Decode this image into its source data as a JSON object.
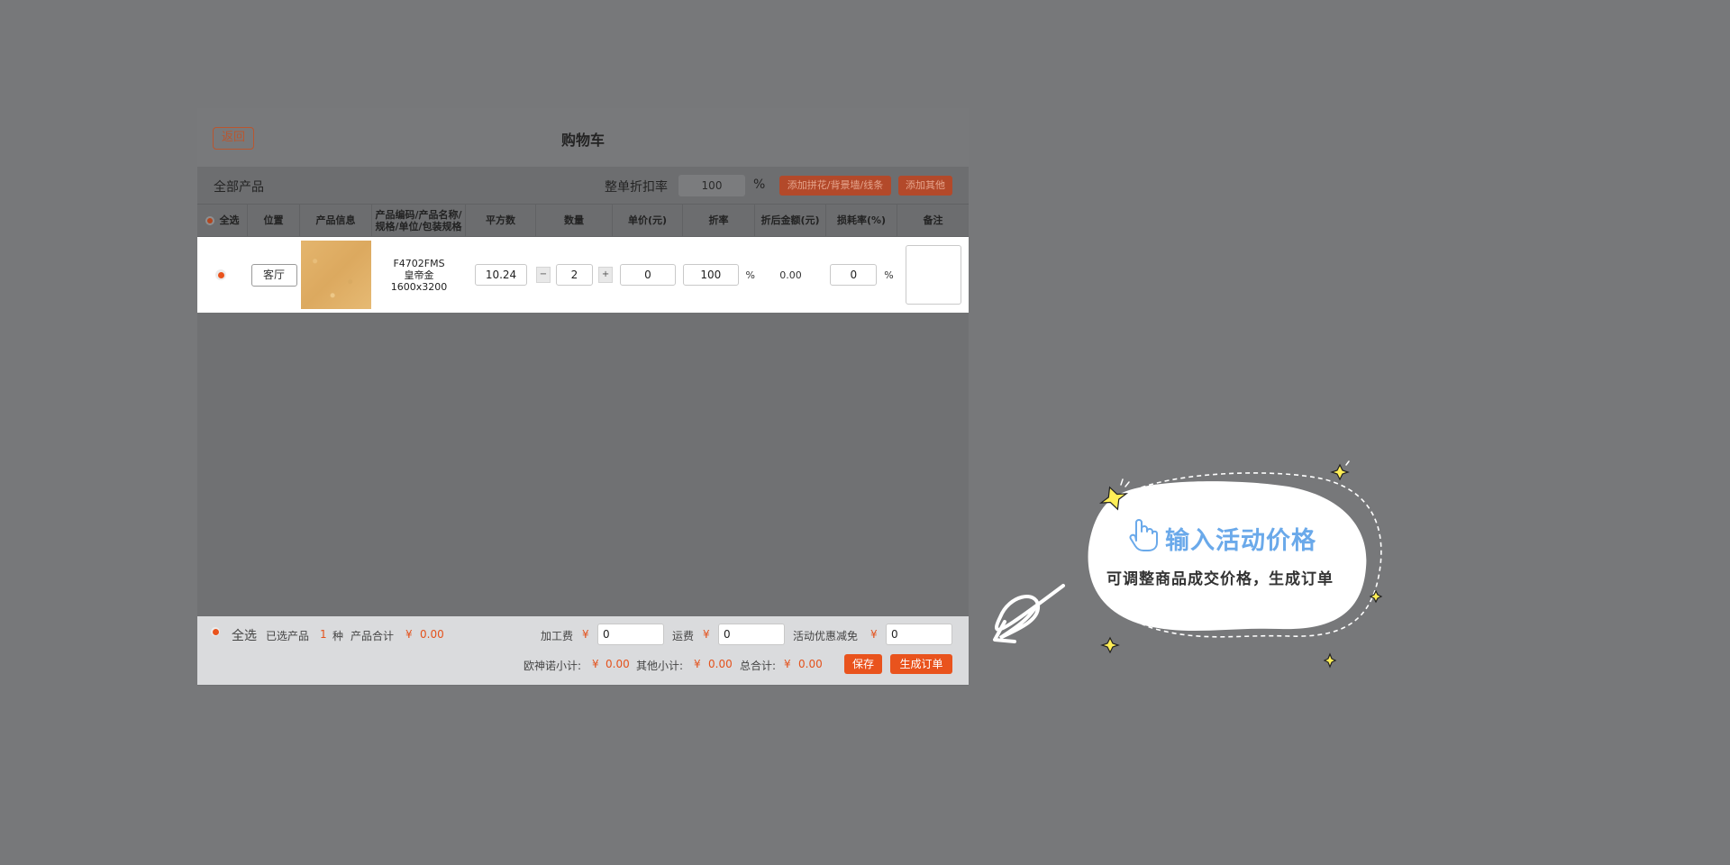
{
  "header": {
    "back_label": "返回",
    "title": "购物车"
  },
  "filter": {
    "label": "全部产品",
    "discount_label": "整单折扣率",
    "discount_value": "100",
    "discount_unit": "%",
    "add_tile_label": "添加拼花/背景墙/线条",
    "add_other_label": "添加其他"
  },
  "table": {
    "columns": [
      "全选",
      "位置",
      "产品信息",
      "产品编码/产品名称/规格/单位/包装规格",
      "平方数",
      "数量",
      "单价(元)",
      "折率",
      "折后金额(元)",
      "损耗率(%)",
      "备注"
    ],
    "rows": [
      {
        "position": "客厅",
        "code": "F4702FMS",
        "name": "皇帝金",
        "spec": "1600x3200",
        "area": "10.24",
        "qty": "2",
        "minus": "−",
        "plus": "+",
        "price": "0",
        "discount": "100",
        "discount_unit": "%",
        "amount": "0.00",
        "loss": "0",
        "loss_unit": "%",
        "remark": ""
      }
    ]
  },
  "footer": {
    "select_all": "全选",
    "selected_prefix": "已选产品",
    "selected_count": "1",
    "selected_suffix": "种",
    "product_total_label": "产品合计",
    "currency": "¥",
    "product_total": "0.00",
    "processing_label": "加工费",
    "processing_value": "0",
    "shipping_label": "运费",
    "shipping_value": "0",
    "promo_label": "活动优惠减免",
    "promo_value": "0",
    "subtotal_oushennuo_label": "欧神诺小计:",
    "subtotal_oushennuo": "0.00",
    "subtotal_other_label": "其他小计:",
    "subtotal_other": "0.00",
    "grand_total_label": "总合计:",
    "grand_total": "0.00",
    "save_label": "保存",
    "create_order_label": "生成订单"
  },
  "callout": {
    "title": "输入活动价格",
    "subtitle": "可调整商品成交价格，生成订单",
    "icon": "pointer-hand-icon"
  },
  "colors": {
    "accent": "#e9531d",
    "overlay": "#77787a",
    "callout_title": "#6aa9ea"
  }
}
